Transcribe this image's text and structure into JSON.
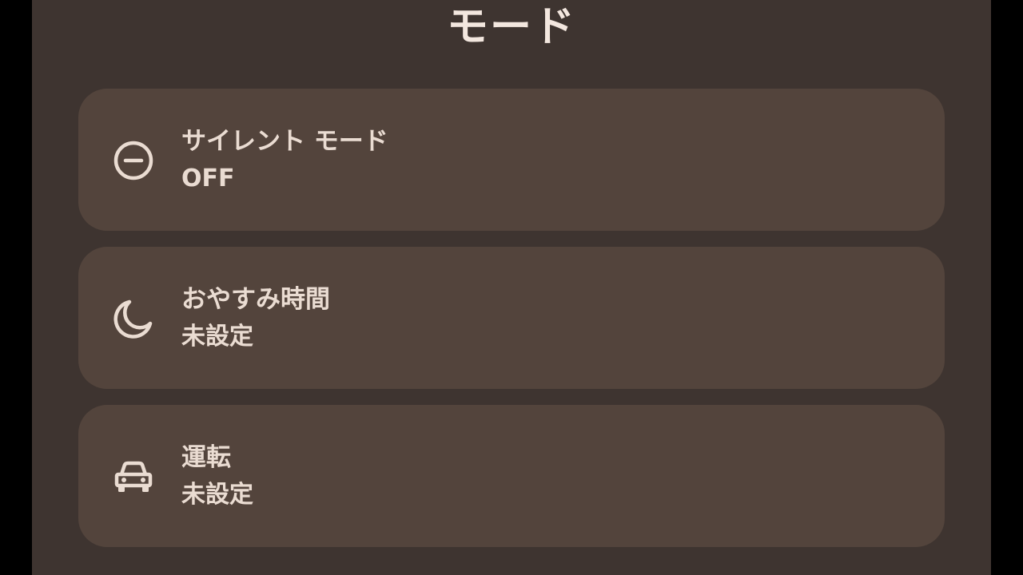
{
  "header": {
    "title": "モード"
  },
  "modes": [
    {
      "icon": "do-not-disturb-icon",
      "title": "サイレント モード",
      "status": "OFF"
    },
    {
      "icon": "moon-icon",
      "title": "おやすみ時間",
      "status": "未設定"
    },
    {
      "icon": "car-icon",
      "title": "運転",
      "status": "未設定"
    }
  ],
  "colors": {
    "background": "#3e3430",
    "card": "#53443c",
    "text": "#eadcd2",
    "title": "#f3e7df"
  }
}
